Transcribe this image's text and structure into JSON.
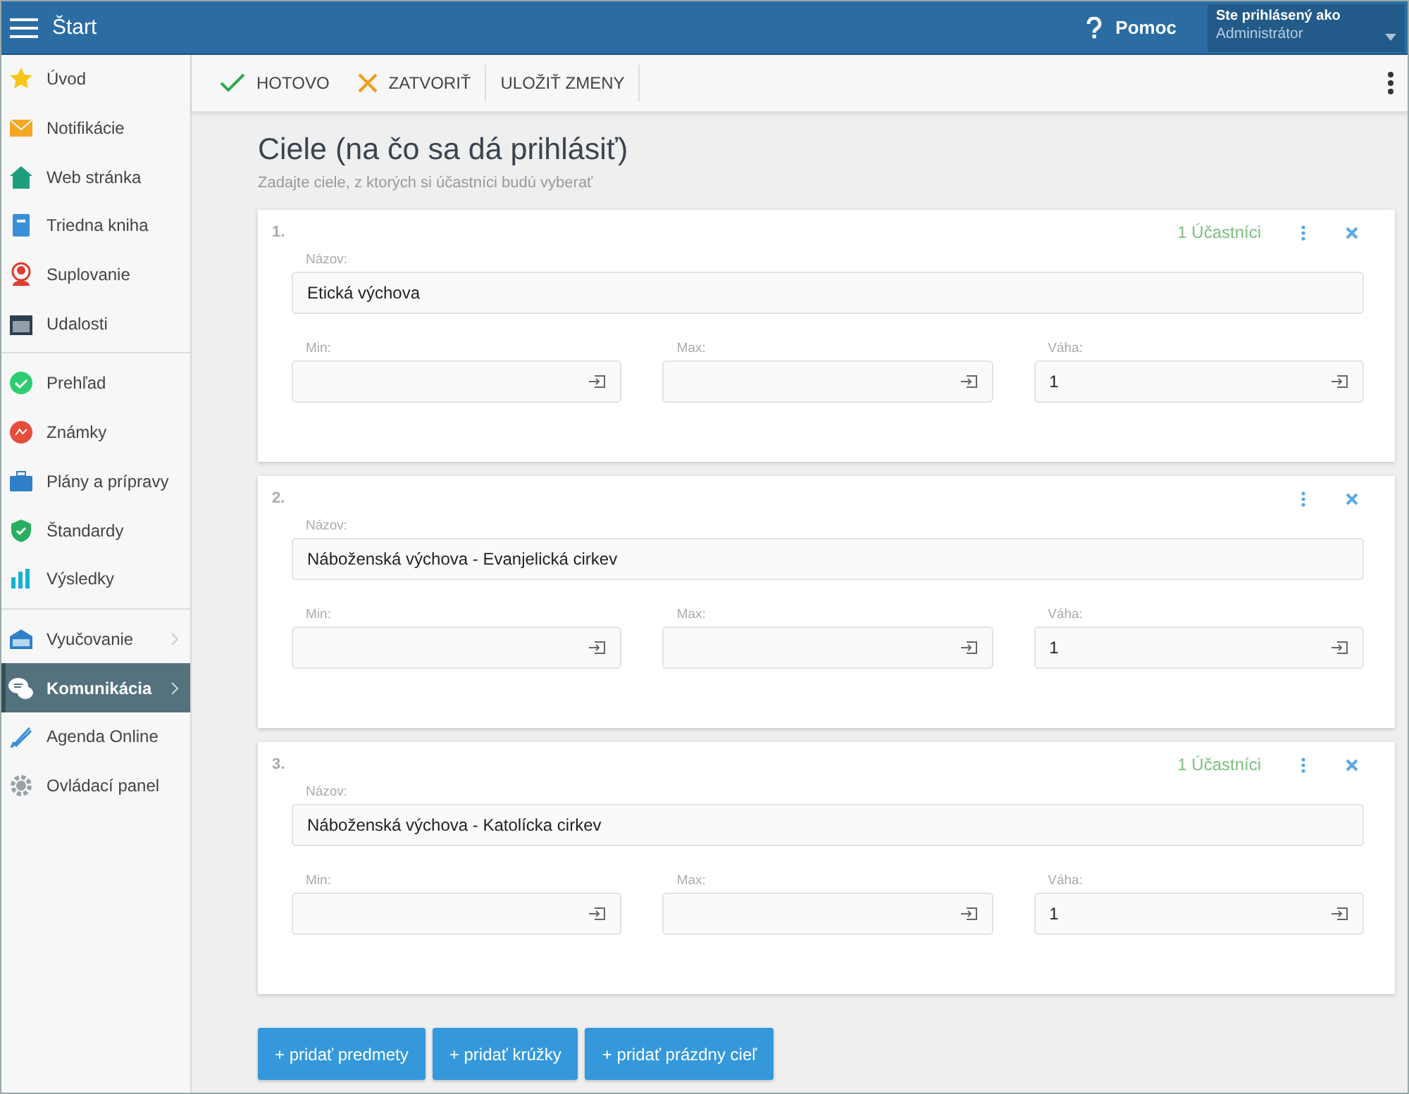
{
  "header": {
    "title": "Štart",
    "help": "Pomoc",
    "user_label": "Ste prihlásený ako",
    "user_name": "Administrátor"
  },
  "toolbar": {
    "buttons": [
      {
        "label": "HOTOVO",
        "kind": "done"
      },
      {
        "label": "ZATVORIŤ",
        "kind": "close"
      },
      {
        "label": "ULOŽIŤ ZMENY",
        "kind": "save"
      }
    ]
  },
  "sidebar": {
    "groups": [
      {
        "items": [
          {
            "label": "Úvod",
            "selected": false
          },
          {
            "label": "Notifikácie",
            "selected": false
          },
          {
            "label": "Web stránka",
            "selected": false
          },
          {
            "label": "Triedna kniha",
            "selected": false
          },
          {
            "label": "Suplovanie",
            "selected": false
          },
          {
            "label": "Udalosti",
            "selected": false
          }
        ]
      },
      {
        "items": [
          {
            "label": "Prehľad",
            "selected": false
          },
          {
            "label": "Známky",
            "selected": false
          },
          {
            "label": "Plány a prípravy",
            "selected": false
          },
          {
            "label": "Štandardy",
            "selected": false
          },
          {
            "label": "Výsledky",
            "selected": false
          }
        ]
      },
      {
        "items": [
          {
            "label": "Vyučovanie",
            "selected": false,
            "submenu": true
          },
          {
            "label": "Komunikácia",
            "selected": true,
            "submenu": true
          },
          {
            "label": "Agenda Online",
            "selected": false
          },
          {
            "label": "Ovládací panel",
            "selected": false
          }
        ]
      }
    ]
  },
  "page": {
    "title": "Ciele (na čo sa dá prihlásiť)",
    "subtitle": "Zadajte ciele, z ktorých si účastníci budú vyberať"
  },
  "goals": [
    {
      "number": "1.",
      "participants": "1 Účastníci",
      "name_label": "Názov:",
      "name": "Etická výchova",
      "min_label": "Min:",
      "max_label": "Max:",
      "weight_label": "Váha:",
      "weight": "1"
    },
    {
      "number": "2.",
      "name_label": "Názov:",
      "name": "Náboženská výchova - Evanjelická cirkev",
      "min_label": "Min:",
      "max_label": "Max:",
      "weight_label": "Váha:",
      "weight": "1"
    },
    {
      "number": "3.",
      "participants": "1 Účastníci",
      "name_label": "Názov:",
      "name": "Náboženská výchova - Katolícka cirkev",
      "min_label": "Min:",
      "max_label": "Max:",
      "weight_label": "Váha:",
      "weight": "1"
    }
  ],
  "actions": [
    "+ pridať predmety",
    "+ pridať krúžky",
    "+ pridať prázdny cieľ"
  ]
}
